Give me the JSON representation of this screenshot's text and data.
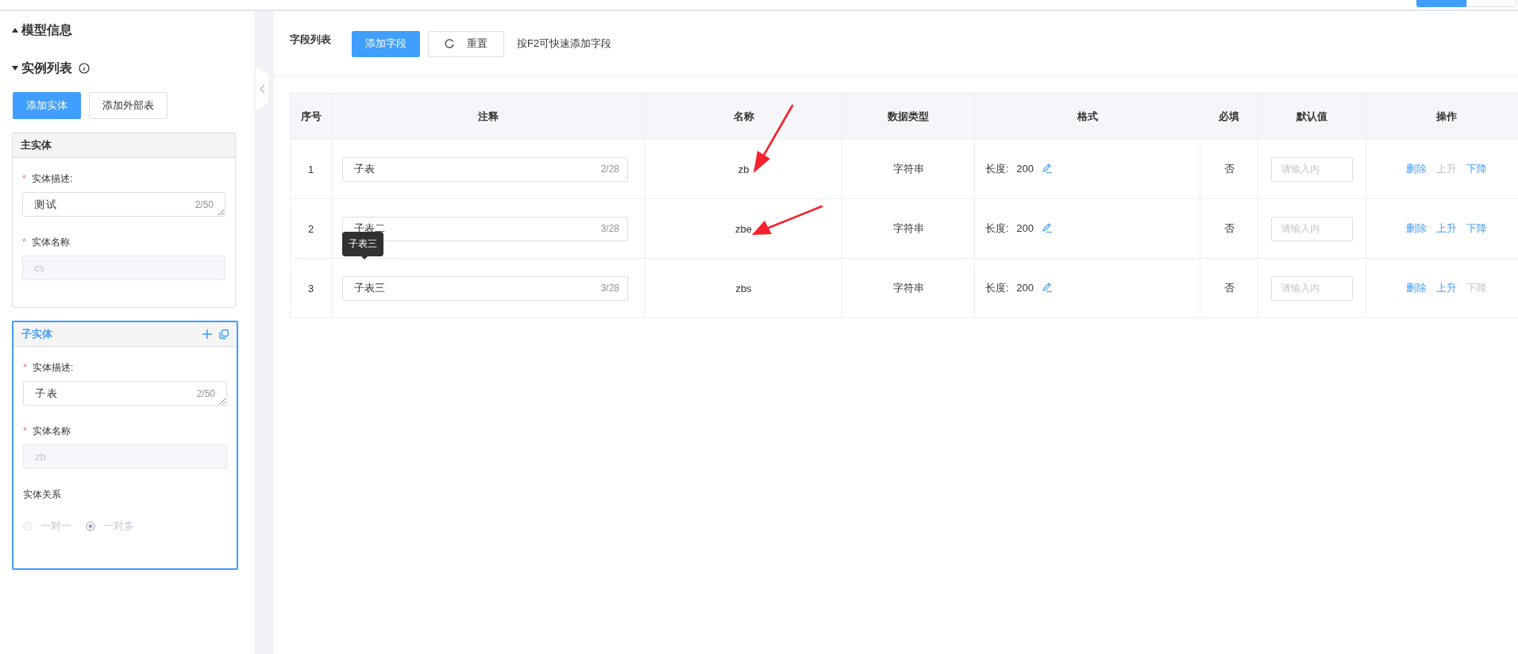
{
  "view_switch": [
    {
      "selected": true
    },
    {
      "selected": false
    }
  ],
  "sidebar": {
    "sections": [
      {
        "title": "模型信息",
        "expanded": false,
        "info": false
      },
      {
        "title": "实例列表",
        "expanded": true,
        "info": true
      }
    ],
    "buttons": [
      {
        "label": "添加实体",
        "kind": "primary"
      },
      {
        "label": "添加外部表",
        "kind": "default"
      }
    ],
    "entities": [
      {
        "title": "主实体",
        "selected": false,
        "fields": [
          {
            "kind": "textarea",
            "label": "实体描述:",
            "required_mark": "*",
            "value": "测试",
            "count": "2/50"
          },
          {
            "kind": "input",
            "label": "实体名称",
            "required_mark": "*",
            "value": "cs",
            "disabled": true
          }
        ]
      },
      {
        "title": "子实体",
        "selected": true,
        "fields": [
          {
            "kind": "textarea",
            "label": "实体描述:",
            "required_mark": "*",
            "value": "子表",
            "count": "2/50"
          },
          {
            "kind": "input",
            "label": "实体名称",
            "required_mark": "*",
            "value": "zb",
            "disabled": true
          },
          {
            "kind": "radio",
            "label": "实体关系",
            "disabled": true,
            "options": [
              {
                "label": "一对一",
                "selected": false
              },
              {
                "label": "一对多",
                "selected": true
              }
            ]
          }
        ]
      }
    ]
  },
  "toolbar": {
    "title": "字段列表",
    "buttons": [
      {
        "label": "添加字段",
        "kind": "primary"
      },
      {
        "label": "重置",
        "kind": "reset"
      }
    ],
    "hint": "按F2可快速添加字段"
  },
  "table": {
    "columns": [
      "序号",
      "注释",
      "名称",
      "数据类型",
      "格式",
      "必填",
      "默认值",
      "操作"
    ],
    "rows": [
      {
        "index": "1",
        "comment": "子表",
        "count": "2/28",
        "name": "zb",
        "arrow": true,
        "type": "字符串",
        "format_label": "长度:",
        "format_value": "200",
        "required": "否",
        "default_placeholder": "请输入内",
        "actions": [
          {
            "label": "删除",
            "disabled": false
          },
          {
            "label": "上升",
            "disabled": true
          },
          {
            "label": "下降",
            "disabled": false
          }
        ]
      },
      {
        "index": "2",
        "comment": "子表二",
        "count": "3/28",
        "name": "zbe",
        "arrow": true,
        "type": "字符串",
        "format_label": "长度:",
        "format_value": "200",
        "required": "否",
        "default_placeholder": "请输入内",
        "actions": [
          {
            "label": "删除",
            "disabled": false
          },
          {
            "label": "上升",
            "disabled": false
          },
          {
            "label": "下降",
            "disabled": false
          }
        ]
      },
      {
        "index": "3",
        "comment": "子表三",
        "count": "3/28",
        "tooltip": "子表三",
        "name": "zbs",
        "arrow": false,
        "type": "字符串",
        "format_label": "长度:",
        "format_value": "200",
        "required": "否",
        "default_placeholder": "请输入内",
        "actions": [
          {
            "label": "删除",
            "disabled": false
          },
          {
            "label": "上升",
            "disabled": false
          },
          {
            "label": "下降",
            "disabled": true
          }
        ]
      }
    ]
  }
}
